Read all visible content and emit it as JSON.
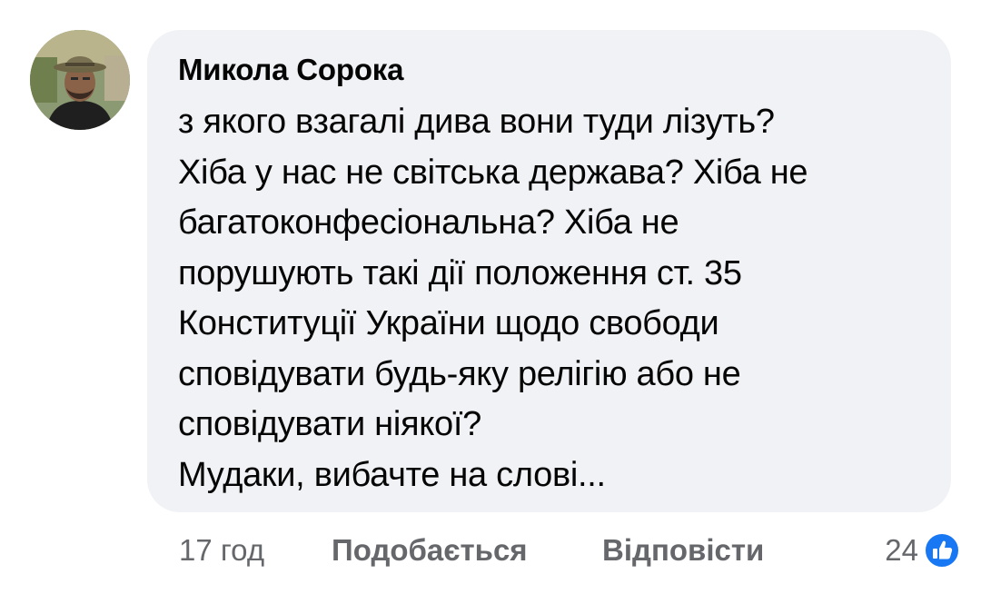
{
  "comment": {
    "author": "Микола Сорока",
    "lines": [
      "з якого взагалі дива вони туди лізуть?",
      "Хіба у нас не світська держава? Хіба не",
      "багатоконфесіональна? Хіба не",
      "порушують такі дії положення ст. 35",
      "Конституції України щодо свободи",
      "сповідувати будь-яку релігію або не",
      "сповідувати ніякої?",
      "Мудаки, вибачте на слові..."
    ]
  },
  "actions": {
    "time": "17 год",
    "like_label": "Подобається",
    "reply_label": "Відповісти",
    "reaction_count": "24",
    "reaction_icon": "thumbs-up-icon"
  },
  "colors": {
    "bubble": "#f0f2f5",
    "text": "#050505",
    "secondary_text": "#65676b",
    "like_blue": "#1877f2"
  }
}
